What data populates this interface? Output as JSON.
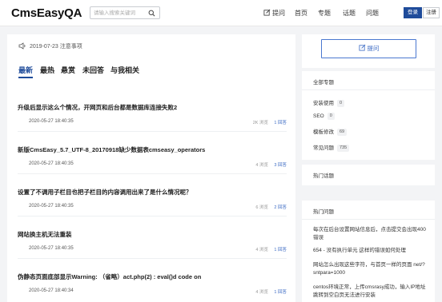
{
  "header": {
    "logo": "CmsEasyQA",
    "search_placeholder": "请输入搜索关键词",
    "nav": {
      "ask": "提问",
      "home": "首页",
      "topic": "专题",
      "tags": "话题",
      "questions": "问题"
    },
    "login_label": "登录",
    "register_label": "注册"
  },
  "main": {
    "notice": "2019-07-23 注意事项",
    "tabs": [
      {
        "label": "最新",
        "active": true
      },
      {
        "label": "最热",
        "active": false
      },
      {
        "label": "悬赏",
        "active": false
      },
      {
        "label": "未回答",
        "active": false
      },
      {
        "label": "与我相关",
        "active": false
      }
    ],
    "questions": [
      {
        "title": "升级后显示这么个情况，开网页和后台都是数据库连接失败2",
        "date": "2020-05-27 18:40:35",
        "views": "2K 浏览",
        "answers": "1 回答"
      },
      {
        "title": "新版CmsEasy_5.7_UTF-8_20170918缺少数据表cmseasy_operators",
        "date": "2020-05-27 18:40:35",
        "views": "4 浏览",
        "answers": "3 回答"
      },
      {
        "title": "设置了不调用子栏目也把子栏目的内容调用出来了是什么情况呢？",
        "date": "2020-05-27 18:40:35",
        "views": "6 浏览",
        "answers": "2 回答"
      },
      {
        "title": "网站换主机无法重装",
        "date": "2020-05-27 18:40:35",
        "views": "4 浏览",
        "answers": "1 回答"
      },
      {
        "title": "伪静态页面底部显示Warning: （省略）act.php(2) : eval()d code on",
        "date": "2020-05-27 18:40:34",
        "views": "4 浏览",
        "answers": "1 回答"
      }
    ]
  },
  "sidebar": {
    "ask_button": "提问",
    "categories_title": "全部专题",
    "categories": [
      {
        "name": "安装使用",
        "count": "0"
      },
      {
        "name": "SEO",
        "count": "0"
      },
      {
        "name": "模板修改",
        "count": "69"
      },
      {
        "name": "常见问题",
        "count": "735"
      }
    ],
    "hot_topics_title": "热门话题",
    "hot_questions_title": "热门问题",
    "hot_questions": [
      "每次在后台设置网站信息后，点击提交会出现400错误",
      "654 - 没有执行单元 这样的错误如何处理",
      "网站怎么出现这些字符，与首页一样的页面 net/?sntpara=1000",
      "centos环境正常，上传cmsrasy成功，输入IP地址跳转到空白页无法进行安装"
    ]
  },
  "colors": {
    "brand_blue": "#1e4b9a",
    "link_blue": "#3c6bc4",
    "background": "#f3f4f6"
  }
}
